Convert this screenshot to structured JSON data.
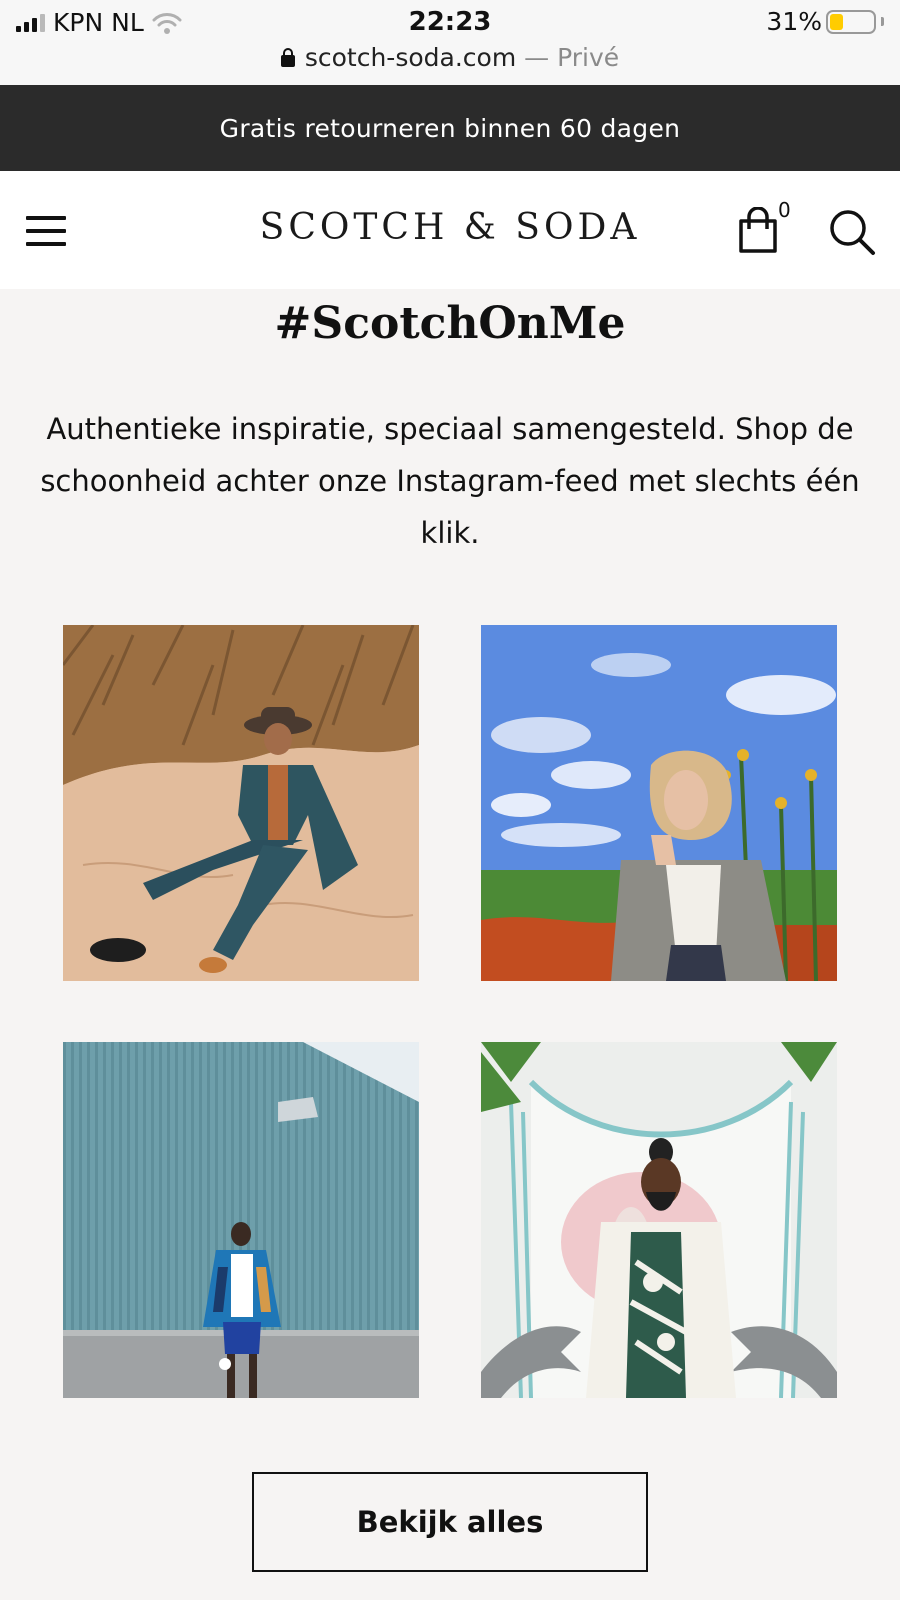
{
  "status_bar": {
    "carrier": "KPN NL",
    "time": "22:23",
    "battery_percent": "31%",
    "battery_level": 0.31,
    "battery_color": "#ffcc00"
  },
  "url_bar": {
    "domain": "scotch-soda.com",
    "suffix": "— Privé"
  },
  "promo_banner": {
    "text": "Gratis retourneren binnen 60 dagen",
    "background": "#2b2b2b"
  },
  "header": {
    "logo": "SCOTCH & SODA",
    "cart_count": "0",
    "icons": [
      "hamburger-menu-icon",
      "shopping-bag-icon",
      "search-icon"
    ]
  },
  "section": {
    "title": "#ScotchOnMe",
    "intro": "Authentieke inspiratie, speciaal samengesteld. Shop de schoonheid achter onze Instagram-feed met slechts één klik.",
    "button_label": "Bekijk alles"
  },
  "photos": [
    {
      "subject": "man seated in sand dunes wearing denim and a hat"
    },
    {
      "subject": "woman in a checked blazer before sunflowers and blue sky"
    },
    {
      "subject": "man in blue jacket standing before a corrugated blue wall"
    },
    {
      "subject": "man in printed shirt in a white room with a shell sculpture and dolphins"
    }
  ]
}
